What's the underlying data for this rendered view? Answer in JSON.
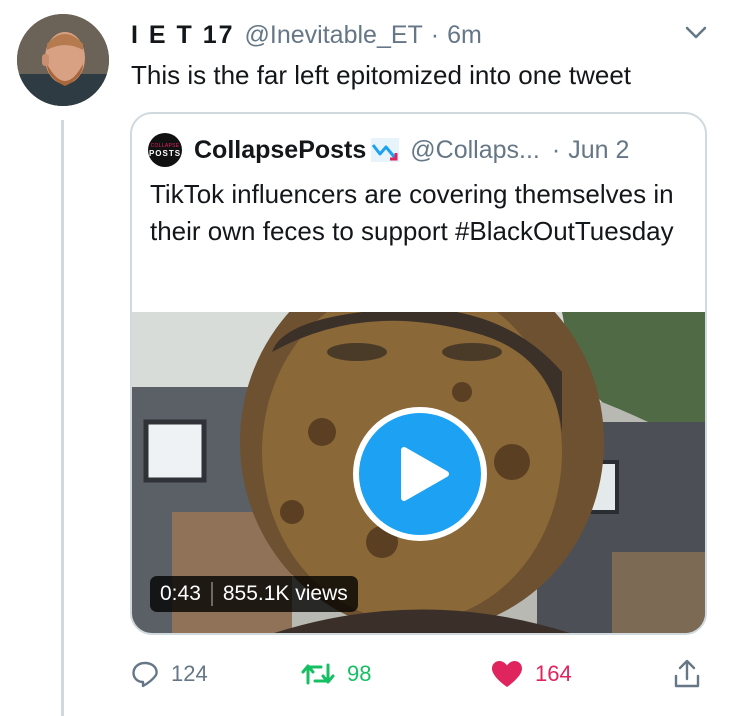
{
  "tweet": {
    "author": {
      "display_name": "I E T 17",
      "handle": "@Inevitable_ET",
      "separator": "·",
      "time": "6m"
    },
    "text": "This is the far left epitomized into one tweet",
    "menu_icon": "chevron-down-icon"
  },
  "quote": {
    "author": {
      "avatar_text_line1": "COLLAPSE",
      "avatar_text_line2": "POSTS",
      "display_name": "CollapsePosts",
      "badge_icon": "chart-down-icon",
      "handle": "@Collaps...",
      "separator": "·",
      "date": "Jun 2"
    },
    "text": "TikTok influencers are covering themselves in their own feces to support #BlackOutTuesday",
    "media": {
      "duration": "0:43",
      "views": "855.1K views",
      "play_icon": "play-icon"
    }
  },
  "actions": {
    "reply": {
      "icon": "reply-icon",
      "count": "124"
    },
    "retweet": {
      "icon": "retweet-icon",
      "count": "98"
    },
    "like": {
      "icon": "heart-icon",
      "count": "164"
    },
    "share": {
      "icon": "share-icon"
    }
  },
  "colors": {
    "link_blue": "#1da1f2",
    "retweet_green": "#17bf63",
    "like_red": "#e0245e",
    "muted_gray": "#657786"
  }
}
